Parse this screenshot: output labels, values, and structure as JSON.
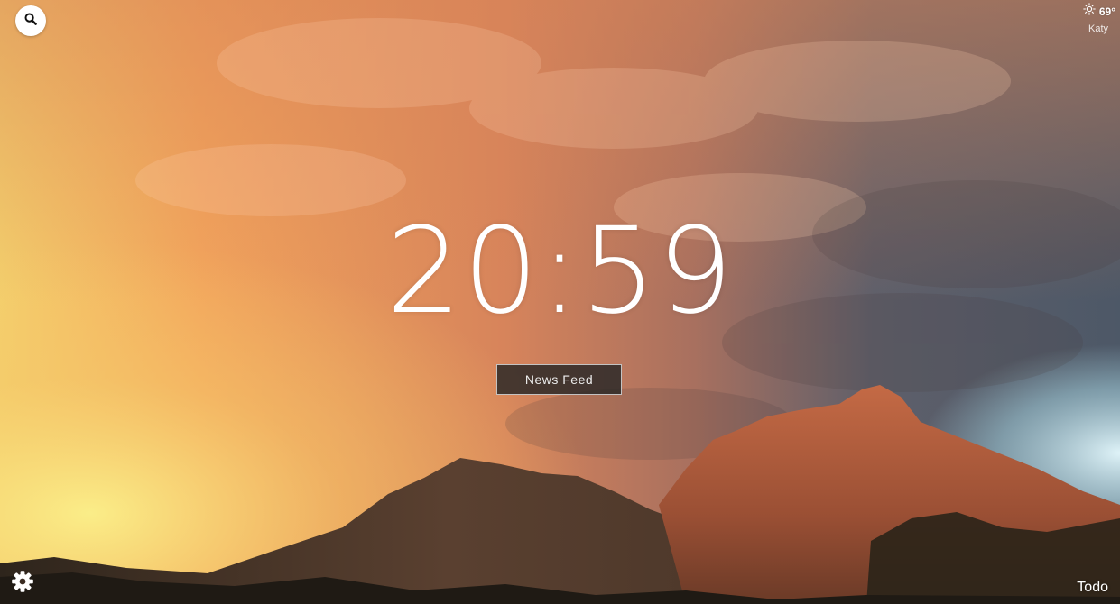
{
  "background": {
    "sky_colors": [
      "#f6e47a",
      "#f0a35a",
      "#c96a45",
      "#6d6a72",
      "#4e5a6b",
      "#bfe3ee"
    ],
    "mountain_colors": [
      "#b35a3b",
      "#7a3e2c",
      "#2d2219"
    ]
  },
  "search": {
    "icon": "search-icon"
  },
  "weather": {
    "icon": "sun-icon",
    "temperature": "69°",
    "city": "Katy"
  },
  "clock": {
    "time": "20:59"
  },
  "news_feed": {
    "label": "News Feed"
  },
  "settings": {
    "icon": "gear-icon"
  },
  "todo": {
    "label": "Todo"
  }
}
